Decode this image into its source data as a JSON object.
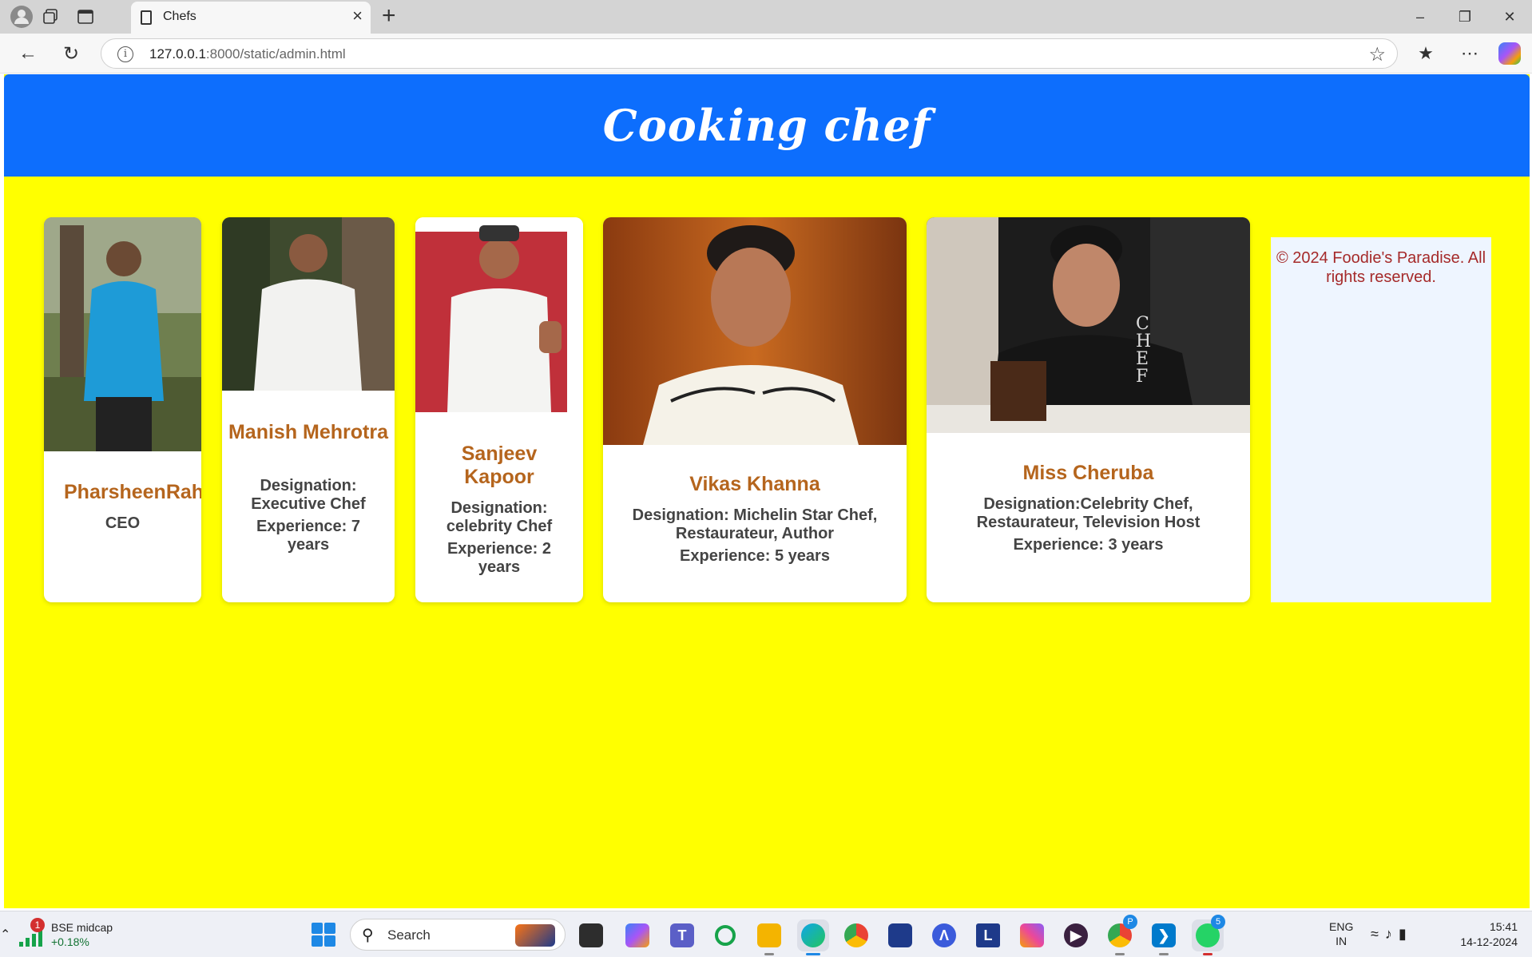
{
  "browser": {
    "tab_title": "Chefs",
    "url_host": "127.0.0.1",
    "url_rest": ":8000/static/admin.html"
  },
  "page": {
    "header_title": "Cooking chef",
    "chefs": [
      {
        "name": "PharsheenRah",
        "designation": "CEO",
        "experience": ""
      },
      {
        "name": "Manish Mehrotra",
        "designation": "Designation: Executive Chef",
        "experience": "Experience: 7 years"
      },
      {
        "name": "Sanjeev Kapoor",
        "designation": "Designation: celebrity Chef",
        "experience": "Experience: 2 years"
      },
      {
        "name": "Vikas Khanna",
        "designation": "Designation: Michelin Star Chef, Restaurateur, Author",
        "experience": "Experience: 5 years"
      },
      {
        "name": "Miss Cheruba",
        "designation": "Designation:Celebrity Chef, Restaurateur, Television Host",
        "experience": "Experience: 3 years"
      }
    ],
    "footer_text": "© 2024 Foodie's Paradise. All rights reserved."
  },
  "taskbar": {
    "widget_badge": "1",
    "widget_title": "BSE midcap",
    "widget_change": "+0.18%",
    "search_label": "Search",
    "teams_badge": "P",
    "whatsapp_badge": "5",
    "lang_1": "ENG",
    "lang_2": "IN",
    "time": "15:41",
    "date": "14-12-2024"
  },
  "colors": {
    "header_bg": "#0d6efd",
    "page_bg": "#ffff00",
    "chef_name": "#b5651d",
    "footer_text": "#a52a2a"
  }
}
